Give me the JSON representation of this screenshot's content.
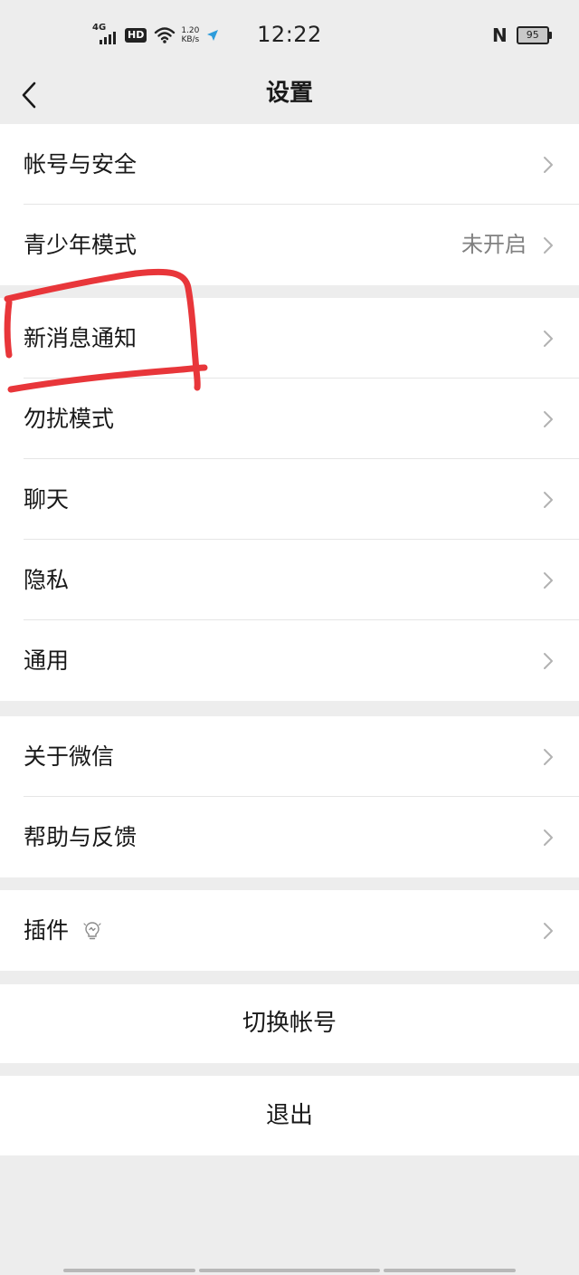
{
  "status_bar": {
    "network_type": "4G",
    "hd_badge": "HD",
    "speed_value": "1.20",
    "speed_unit": "KB/s",
    "time": "12:22",
    "nfc_symbol": "N",
    "battery_level": "95"
  },
  "nav": {
    "title": "设置"
  },
  "groups": [
    {
      "items": [
        {
          "label": "帐号与安全",
          "value": ""
        },
        {
          "label": "青少年模式",
          "value": "未开启"
        }
      ]
    },
    {
      "items": [
        {
          "label": "新消息通知",
          "value": ""
        },
        {
          "label": "勿扰模式",
          "value": ""
        },
        {
          "label": "聊天",
          "value": ""
        },
        {
          "label": "隐私",
          "value": ""
        },
        {
          "label": "通用",
          "value": ""
        }
      ]
    },
    {
      "items": [
        {
          "label": "关于微信",
          "value": ""
        },
        {
          "label": "帮助与反馈",
          "value": ""
        }
      ]
    },
    {
      "items": [
        {
          "label": "插件",
          "value": ""
        }
      ]
    }
  ],
  "actions": {
    "switch_account": "切换帐号",
    "logout": "退出"
  },
  "colors": {
    "background": "#ededed",
    "card": "#ffffff",
    "text": "#191919",
    "secondary_text": "#808080",
    "annotation": "#e8363a"
  }
}
